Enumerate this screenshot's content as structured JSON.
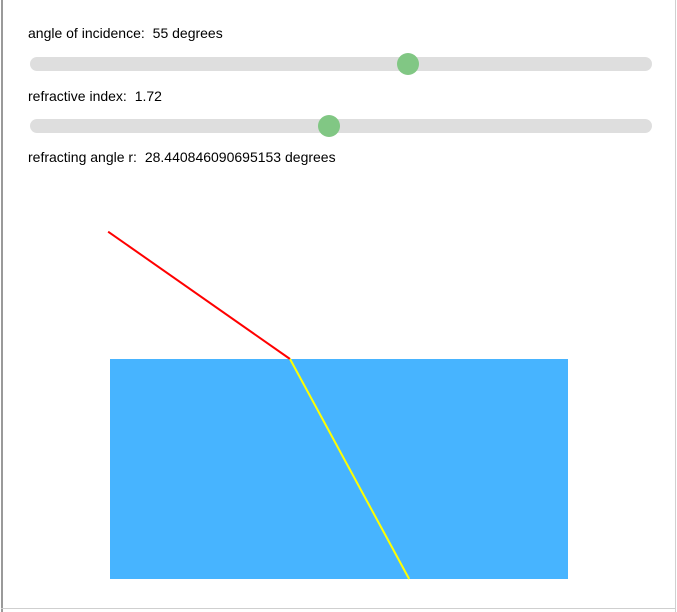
{
  "incidence": {
    "label": "angle of incidence:",
    "value": 55,
    "unit": "degrees",
    "range": [
      0,
      90
    ]
  },
  "refraction": {
    "label": "refractive index:",
    "value": 1.72,
    "range": [
      1,
      2.5
    ]
  },
  "result": {
    "label": "refracting angle r:",
    "value": 28.440846090695153,
    "unit": "degrees"
  },
  "colors": {
    "medium": "#47b4ff",
    "incident_ray": "#ff0000",
    "refracted_ray": "#ffff00",
    "slider_track": "#dedede",
    "slider_thumb": "#81c784"
  }
}
